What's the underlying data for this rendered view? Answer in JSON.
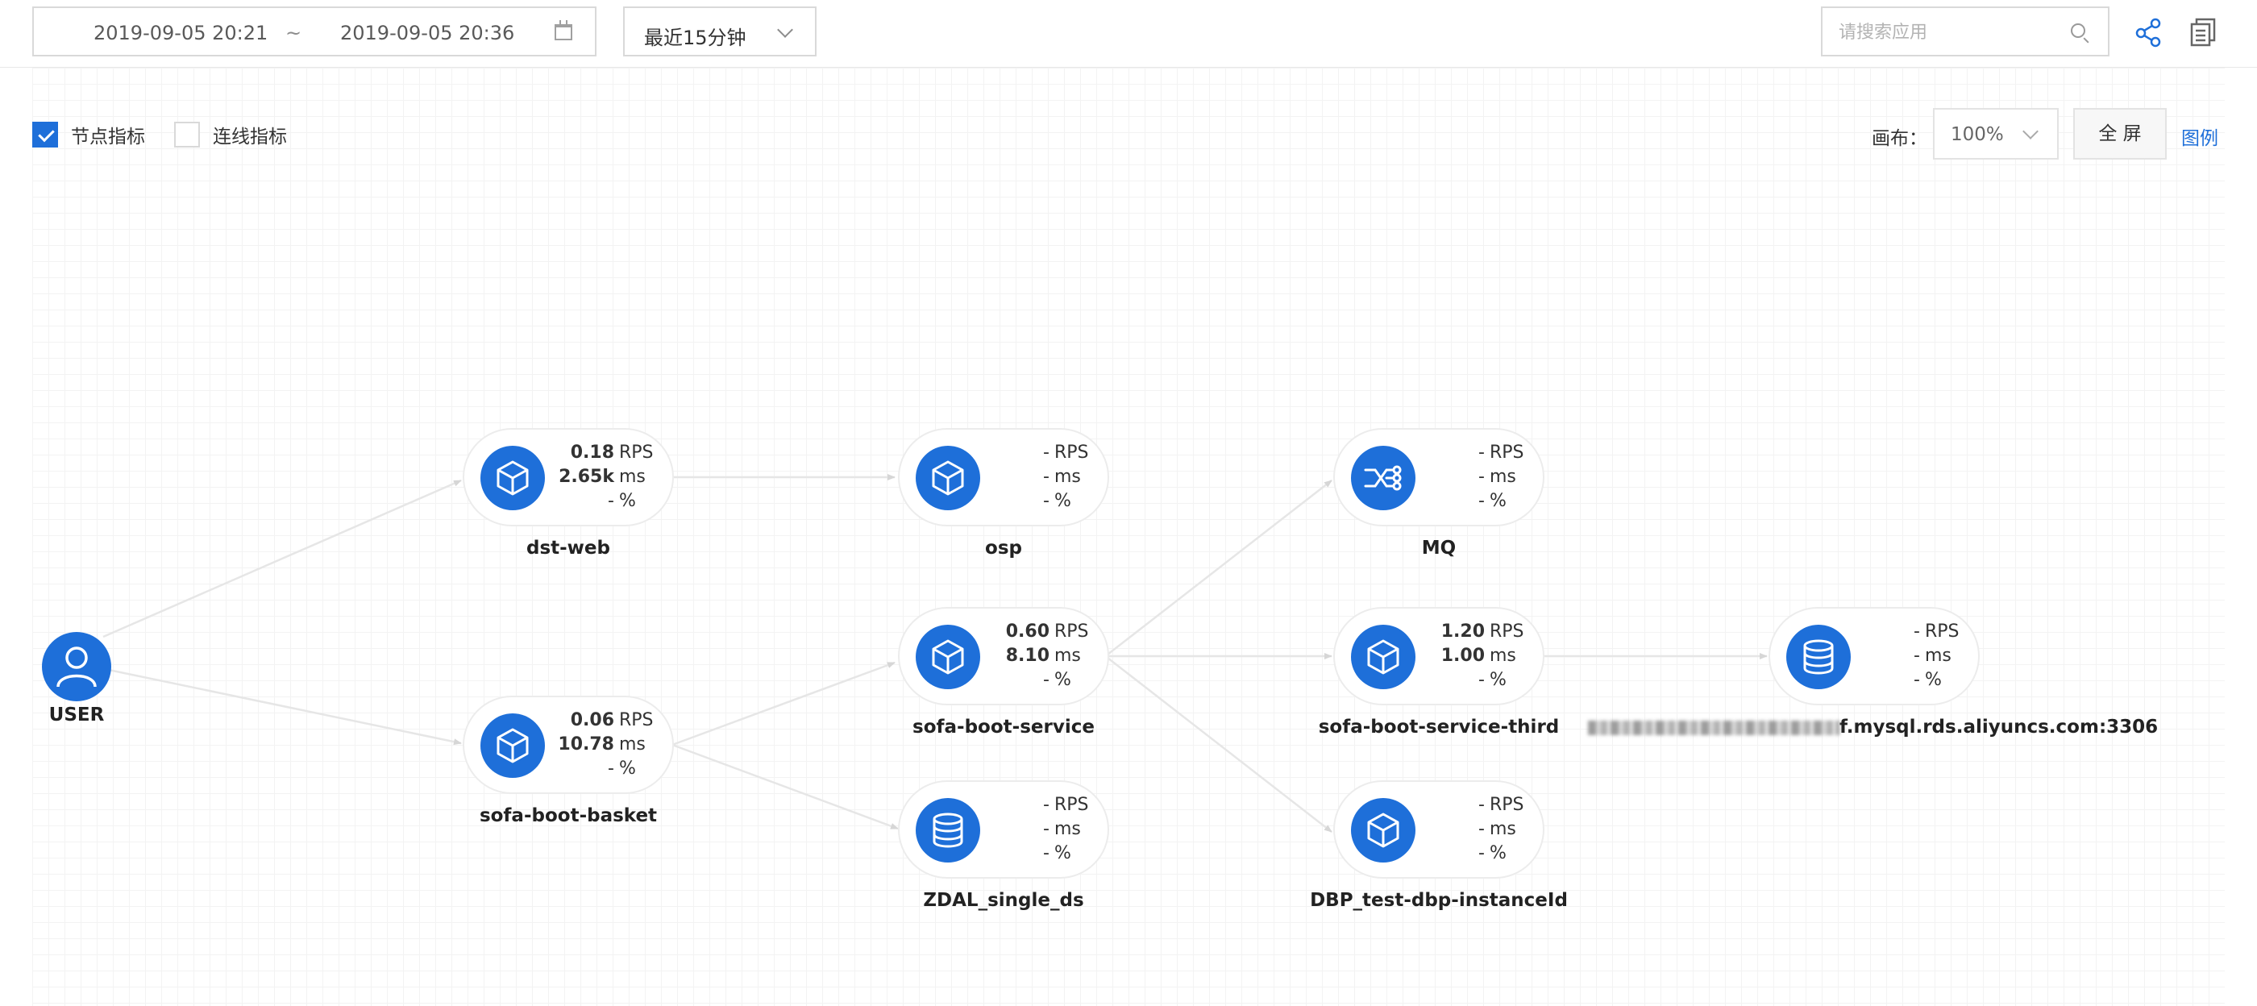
{
  "toolbar": {
    "date_start": "2019-09-05 20:21",
    "date_sep": "~",
    "date_end": "2019-09-05 20:36",
    "time_range": "最近15分钟",
    "search_placeholder": "请搜索应用"
  },
  "options": {
    "node_metrics_label": "节点指标",
    "node_metrics_checked": true,
    "link_metrics_label": "连线指标",
    "link_metrics_checked": false,
    "canvas_label": "画布：",
    "zoom": "100%",
    "fullscreen_label": "全 屏",
    "legend_label": "图例"
  },
  "colors": {
    "accent": "#1e6fd9",
    "edge": "#e6e6e6",
    "pill_border": "#ececec"
  },
  "user": {
    "label": "USER",
    "icon": "user-icon"
  },
  "nodes": [
    {
      "id": "dst-web",
      "label": "dst-web",
      "icon": "cube-icon",
      "rps": "0.18",
      "ms": "2.65k",
      "pct": "-"
    },
    {
      "id": "osp",
      "label": "osp",
      "icon": "cube-icon",
      "rps": "-",
      "ms": "-",
      "pct": "-"
    },
    {
      "id": "mq",
      "label": "MQ",
      "icon": "mq-icon",
      "rps": "-",
      "ms": "-",
      "pct": "-"
    },
    {
      "id": "sofa-boot-service",
      "label": "sofa-boot-service",
      "icon": "cube-icon",
      "rps": "0.60",
      "ms": "8.10",
      "pct": "-"
    },
    {
      "id": "sofa-boot-service-third",
      "label": "sofa-boot-service-third",
      "icon": "cube-icon",
      "rps": "1.20",
      "ms": "1.00",
      "pct": "-"
    },
    {
      "id": "mysql",
      "label": "f.mysql.rds.aliyuncs.com:3306",
      "icon": "database-icon",
      "rps": "-",
      "ms": "-",
      "pct": "-"
    },
    {
      "id": "sofa-boot-basket",
      "label": "sofa-boot-basket",
      "icon": "cube-icon",
      "rps": "0.06",
      "ms": "10.78",
      "pct": "-"
    },
    {
      "id": "zdal",
      "label": "ZDAL_single_ds",
      "icon": "database-icon",
      "rps": "-",
      "ms": "-",
      "pct": "-"
    },
    {
      "id": "dbp",
      "label": "DBP_test-dbp-instanceId",
      "icon": "cube-icon",
      "rps": "-",
      "ms": "-",
      "pct": "-"
    }
  ],
  "units": {
    "rps": "RPS",
    "ms": "ms",
    "pct": "%"
  }
}
